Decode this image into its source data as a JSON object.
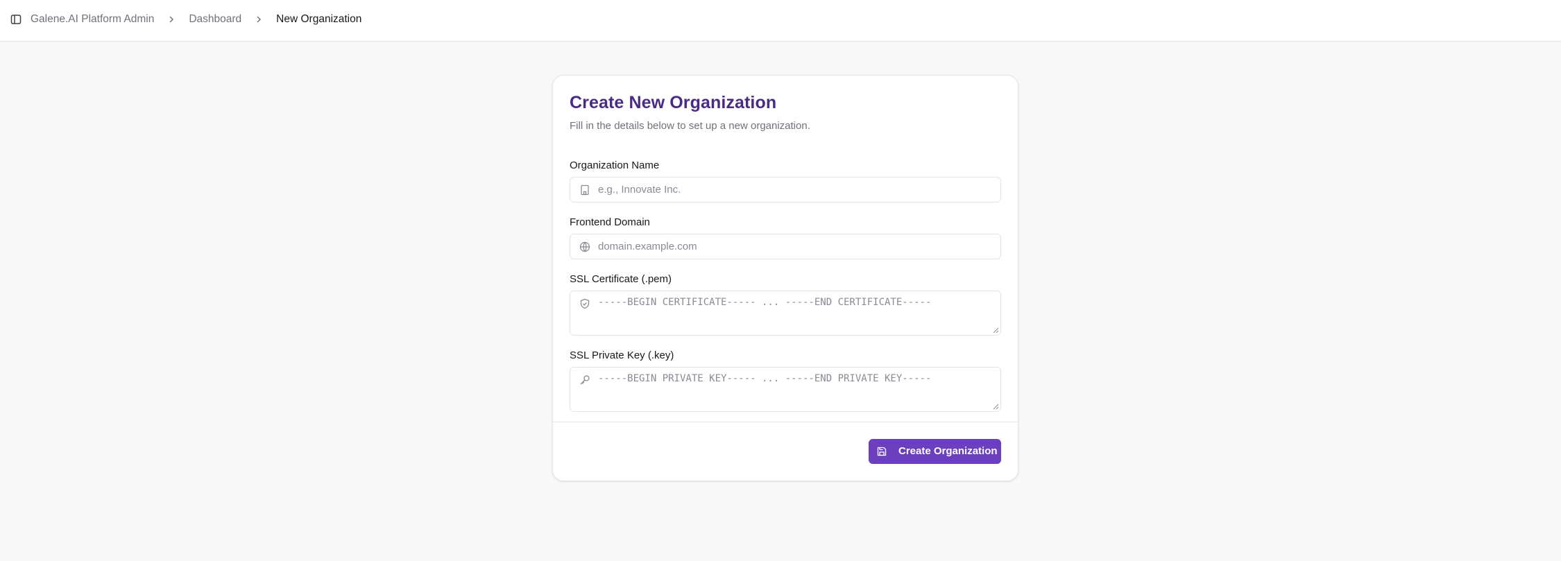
{
  "header": {
    "breadcrumb": [
      {
        "label": "Galene.AI Platform Admin"
      },
      {
        "label": "Dashboard"
      },
      {
        "label": "New Organization"
      }
    ]
  },
  "form": {
    "title": "Create New Organization",
    "subtitle": "Fill in the details below to set up a new organization.",
    "fields": {
      "org_name": {
        "label": "Organization Name",
        "value": "",
        "placeholder": "e.g., Innovate Inc.",
        "icon": "building-icon"
      },
      "frontend_domain": {
        "label": "Frontend Domain",
        "value": "",
        "placeholder": "domain.example.com",
        "icon": "globe-icon"
      },
      "ssl_certificate": {
        "label": "SSL Certificate (.pem)",
        "value": "",
        "placeholder": "-----BEGIN CERTIFICATE----- ... -----END CERTIFICATE-----",
        "icon": "shield-check-icon"
      },
      "ssl_private_key": {
        "label": "SSL Private Key (.key)",
        "value": "",
        "placeholder": "-----BEGIN PRIVATE KEY----- ... -----END PRIVATE KEY-----",
        "icon": "key-icon"
      }
    },
    "submit_label": "Create Organization",
    "submit_icon": "save-icon"
  },
  "colors": {
    "accent": "#6c3fbf",
    "title": "#4a2a82",
    "background": "#f8f8f8",
    "muted_text": "#71717a"
  }
}
